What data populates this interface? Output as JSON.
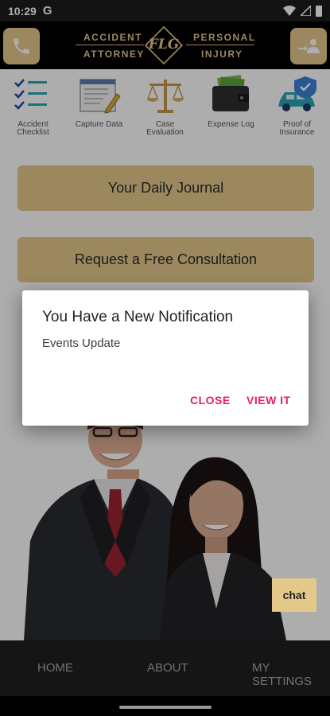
{
  "status_bar": {
    "time": "10:29",
    "carrier_icon": "G"
  },
  "header": {
    "left_button_icon": "phone-icon",
    "right_button_icon": "share-contact-icon",
    "logo": {
      "top_left": "ACCIDENT",
      "top_right": "PERSONAL",
      "bottom_left": "ATTORNEY",
      "bottom_right": "INJURY",
      "monogram": "FLG"
    }
  },
  "quick_actions": [
    {
      "label": "Accident Checklist",
      "icon": "checklist-icon"
    },
    {
      "label": "Capture Data",
      "icon": "document-pencil-icon"
    },
    {
      "label": "Case Evaluation",
      "icon": "scales-icon"
    },
    {
      "label": "Expense Log",
      "icon": "wallet-icon"
    },
    {
      "label": "Proof of Insurance",
      "icon": "car-shield-icon"
    }
  ],
  "buttons": {
    "journal": "Your Daily Journal",
    "consultation": "Request a Free Consultation"
  },
  "chat": {
    "label": "chat"
  },
  "bottom_nav": {
    "home": "HOME",
    "about": "ABOUT",
    "settings": "MY SETTINGS"
  },
  "dialog": {
    "title": "You Have a New Notification",
    "message": "Events Update",
    "close": "CLOSE",
    "view": "VIEW IT"
  },
  "colors": {
    "gold": "#e5c98b",
    "accent_pink": "#e91e63",
    "header_black": "#000000",
    "nav_dark": "#1f1f1f"
  }
}
